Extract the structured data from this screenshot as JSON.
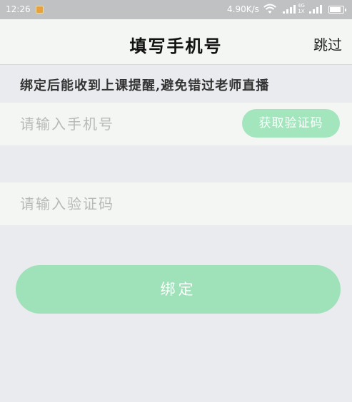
{
  "status_bar": {
    "time": "12:26",
    "net_speed": "4.90K/s",
    "network_type_top": "4G",
    "network_type_bottom": "1X",
    "battery_level": 0.85,
    "icons": [
      "notification-icon",
      "wifi-icon",
      "signal-icon",
      "battery-icon"
    ]
  },
  "header": {
    "title": "填写手机号",
    "skip_label": "跳过"
  },
  "hint": "绑定后能收到上课提醒,避免错过老师直播",
  "form": {
    "phone_placeholder": "请输入手机号",
    "phone_value": "",
    "get_code_label": "获取验证码",
    "code_placeholder": "请输入验证码",
    "code_value": "",
    "bind_label": "绑定"
  },
  "colors": {
    "accent": "#9fe2b9",
    "page_bg": "#e9ebee",
    "row_bg": "#f4f6f3",
    "status_bar_bg": "#bfc1c2"
  }
}
